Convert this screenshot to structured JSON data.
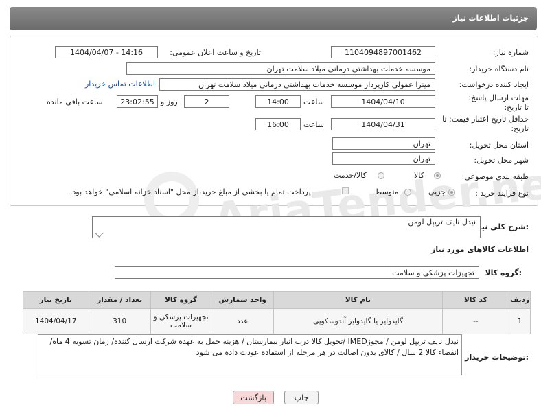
{
  "header": {
    "title": "جزئیات اطلاعات نیاز"
  },
  "labels": {
    "need_number": "شماره نیاز:",
    "announce_datetime": "تاریخ و ساعت اعلان عمومی:",
    "buyer_org": "نام دستگاه خریدار:",
    "requester": "ایجاد کننده درخواست:",
    "reply_deadline": "مهلت ارسال پاسخ: تا تاریخ:",
    "hour": "ساعت",
    "day_and": "روز و",
    "remaining": "ساعت باقی مانده",
    "min_price_validity": "حداقل تاریخ اعتبار قیمت: تا تاریخ:",
    "delivery_province": "استان محل تحویل:",
    "delivery_city": "شهر محل تحویل:",
    "category": "طبقه بندی موضوعی:",
    "purchase_process": "نوع فرآیند خرید :",
    "general_desc": "شرح کلی نیاز:",
    "goods_info": "اطلاعات کالاهای مورد نیاز",
    "goods_group": "گروه کالا:",
    "buyer_notes": "توضیحات خریدار:"
  },
  "values": {
    "need_number": "1104094897001462",
    "announce_datetime": "1404/04/07 - 14:16",
    "buyer_org": "موسسه خدمات بهداشتی درمانی میلاد سلامت تهران",
    "requester": "میترا عمولی کارپرداز موسسه خدمات بهداشتی درمانی میلاد سلامت تهران",
    "contact_link": "اطلاعات تماس خریدار",
    "reply_date": "1404/04/10",
    "reply_hour": "14:00",
    "reply_days": "2",
    "reply_remaining": "23:02:55",
    "price_date": "1404/04/31",
    "price_hour": "16:00",
    "province": "تهران",
    "city": "تهران",
    "category_options": [
      "کالا",
      "کالا/خدمت"
    ],
    "process_options": [
      "جزیی",
      "متوسط"
    ],
    "payment_note": "پرداخت تمام یا بخشی از مبلغ خرید،از محل \"اسناد خزانه اسلامی\" خواهد بود.",
    "general_desc": "نیدل نایف تریپل لومن",
    "goods_group": "تجهیزات پزشکی و سلامت",
    "notes": "نیدل نایف تریپل لومن  / مجوزIMED /تحویل کالا درب انبار بیمارستان / هزینه حمل به عهده شرکت ارسال کننده/ زمان تسویه 4 ماه/ انقضاء کالا 2 سال / کالای بدون اصالت در هر مرحله از استفاده عودت داده می شود"
  },
  "table": {
    "headers": [
      "ردیف",
      "کد کالا",
      "نام کالا",
      "واحد شمارش",
      "گروه کالا",
      "تعداد / مقدار",
      "تاریخ نیاز"
    ],
    "rows": [
      [
        "1",
        "--",
        "گایدوایر یا گایدوایر آندوسکوپی",
        "عدد",
        "تجهیزات پزشکی و سلامت",
        "310",
        "1404/04/17"
      ]
    ]
  },
  "buttons": {
    "print": "چاپ",
    "back": "بازگشت"
  },
  "watermark": {
    "text": "AriaTender.neT"
  },
  "colors": {
    "header_bg": "#787878",
    "link": "#1a4fa8",
    "back_btn": "#f7d7d7"
  }
}
